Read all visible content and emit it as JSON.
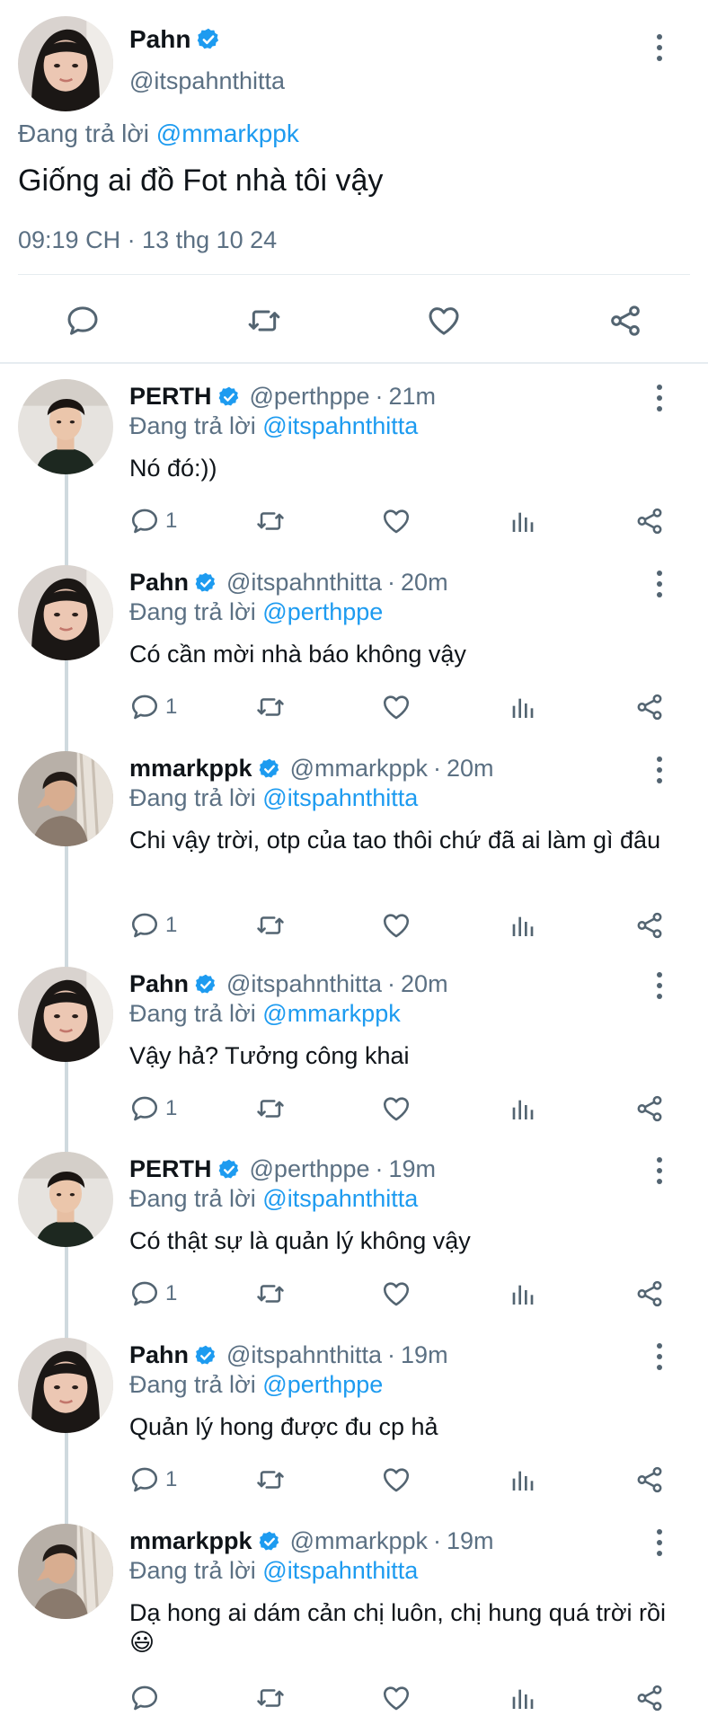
{
  "main_tweet": {
    "author_name": "Pahn",
    "author_handle": "@itspahnthitta",
    "replying_prefix": "Đang trả lời",
    "replying_to": "@mmarkppk",
    "text": "Giống ai đồ Fot nhà tôi vậy",
    "timestamp": "09:19 CH · 13 thg 10 24",
    "actions": [
      "reply-icon",
      "retweet-icon",
      "like-icon",
      "share-icon"
    ]
  },
  "colors": {
    "link": "#1d9bf0",
    "secondary_text": "#5b7083",
    "primary_text": "#0f1419",
    "verified": "#1d9bf0",
    "thread_line": "#cfd9de"
  },
  "replies": [
    {
      "name": "PERTH",
      "handle": "@perthppe",
      "time": "21m",
      "replying_prefix": "Đang trả lời",
      "replying_to": "@itspahnthitta",
      "text": "Nó đó:))",
      "reply_count": "1",
      "avatar": "perth"
    },
    {
      "name": "Pahn",
      "handle": "@itspahnthitta",
      "time": "20m",
      "replying_prefix": "Đang trả lời",
      "replying_to": "@perthppe",
      "text": "Có cần mời nhà báo không vậy",
      "reply_count": "1",
      "avatar": "pahn"
    },
    {
      "name": "mmarkppk",
      "handle": "@mmarkppk",
      "time": "20m",
      "replying_prefix": "Đang trả lời",
      "replying_to": "@itspahnthitta",
      "text": "Chi vậy trời, otp của tao thôi chứ đã ai làm gì đâu",
      "reply_count": "1",
      "avatar": "mark"
    },
    {
      "name": "Pahn",
      "handle": "@itspahnthitta",
      "time": "20m",
      "replying_prefix": "Đang trả lời",
      "replying_to": "@mmarkppk",
      "text": "Vậy hả? Tưởng công khai",
      "reply_count": "1",
      "avatar": "pahn"
    },
    {
      "name": "PERTH",
      "handle": "@perthppe",
      "time": "19m",
      "replying_prefix": "Đang trả lời",
      "replying_to": "@itspahnthitta",
      "text": "Có thật sự là quản lý không vậy",
      "reply_count": "1",
      "avatar": "perth"
    },
    {
      "name": "Pahn",
      "handle": "@itspahnthitta",
      "time": "19m",
      "replying_prefix": "Đang trả lời",
      "replying_to": "@perthppe",
      "text": "Quản lý hong được đu cp hả",
      "reply_count": "1",
      "avatar": "pahn"
    },
    {
      "name": "mmarkppk",
      "handle": "@mmarkppk",
      "time": "19m",
      "replying_prefix": "Đang trả lời",
      "replying_to": "@itspahnthitta",
      "text": "Dạ hong ai dám cản chị luôn, chị hung quá trời rồi😃",
      "reply_count": "",
      "avatar": "mark"
    }
  ]
}
